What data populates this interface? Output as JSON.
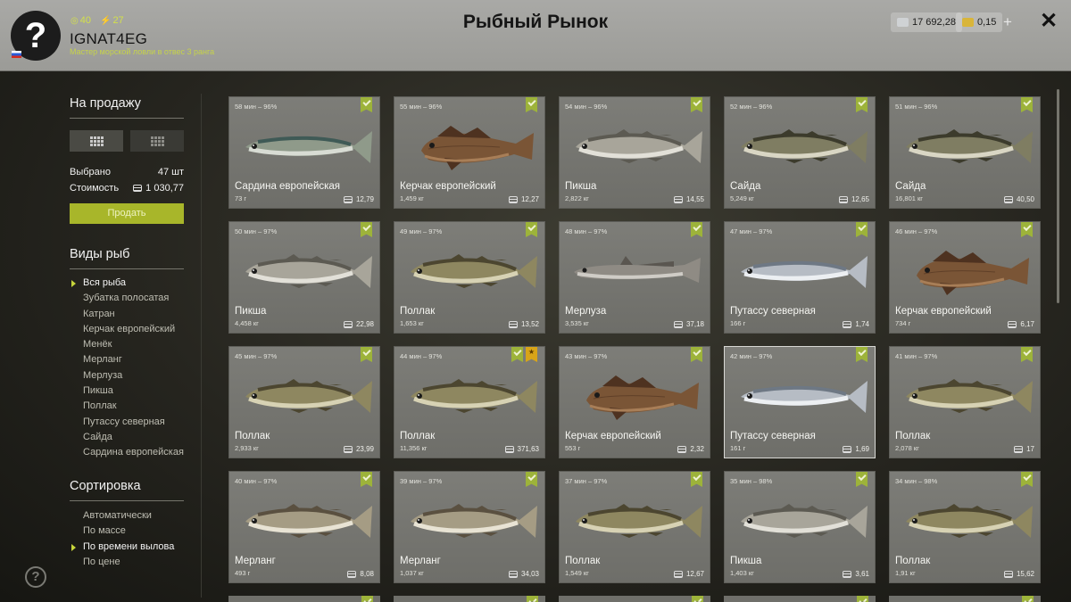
{
  "header": {
    "title": "Рыбный Рынок",
    "avatar_glyph": "?",
    "username": "IGNAT4EG",
    "rank_text": "Мастер морской ловли в отвес 3 ранга",
    "stat_1": "40",
    "stat_2": "27",
    "silver": "17 692,28",
    "gold": "0,15",
    "add_label": "+",
    "close_label": "✕",
    "colors": {
      "accent": "#d3e04a",
      "silver_coin": "#cfd2d4",
      "gold_coin": "#d9b53a"
    }
  },
  "sidebar": {
    "sale_heading": "На продажу",
    "selected_label": "Выбрано",
    "selected_value": "47 шт",
    "cost_label": "Стоимость",
    "cost_value": "1 030,77",
    "sell_button": "Продать",
    "species_heading": "Виды рыб",
    "species": [
      "Вся рыба",
      "Зубатка полосатая",
      "Катран",
      "Керчак европейский",
      "Менёк",
      "Мерланг",
      "Мерлуза",
      "Пикша",
      "Поллак",
      "Путассу северная",
      "Сайда",
      "Сардина европейская"
    ],
    "species_active": 0,
    "sort_heading": "Сортировка",
    "sort_options": [
      "Автоматически",
      "По массе",
      "По времени вылова",
      "По цене"
    ],
    "sort_active": 2,
    "help_glyph": "?"
  },
  "cards": [
    {
      "time": "58 мин – 96%",
      "name": "Сардина европейская",
      "weight": "73 г",
      "price": "12,79",
      "fish": "sardine"
    },
    {
      "time": "55 мин – 96%",
      "name": "Керчак европейский",
      "weight": "1,459 кг",
      "price": "12,27",
      "fish": "sculpin"
    },
    {
      "time": "54 мин – 96%",
      "name": "Пикша",
      "weight": "2,822 кг",
      "price": "14,55",
      "fish": "haddock"
    },
    {
      "time": "52 мин – 96%",
      "name": "Сайда",
      "weight": "5,249 кг",
      "price": "12,65",
      "fish": "saithe"
    },
    {
      "time": "51 мин – 96%",
      "name": "Сайда",
      "weight": "16,801 кг",
      "price": "40,50",
      "fish": "saithe"
    },
    {
      "time": "50 мин – 97%",
      "name": "Пикша",
      "weight": "4,458 кг",
      "price": "22,98",
      "fish": "haddock"
    },
    {
      "time": "49 мин – 97%",
      "name": "Поллак",
      "weight": "1,653 кг",
      "price": "13,52",
      "fish": "pollack"
    },
    {
      "time": "48 мин – 97%",
      "name": "Мерлуза",
      "weight": "3,535 кг",
      "price": "37,18",
      "fish": "hake"
    },
    {
      "time": "47 мин – 97%",
      "name": "Путассу северная",
      "weight": "166 г",
      "price": "1,74",
      "fish": "whiting-blue"
    },
    {
      "time": "46 мин – 97%",
      "name": "Керчак европейский",
      "weight": "734 г",
      "price": "6,17",
      "fish": "sculpin"
    },
    {
      "time": "45 мин – 97%",
      "name": "Поллак",
      "weight": "2,933 кг",
      "price": "23,99",
      "fish": "pollack"
    },
    {
      "time": "44 мин – 97%",
      "name": "Поллак",
      "weight": "11,356 кг",
      "price": "371,63",
      "fish": "pollack",
      "star": true
    },
    {
      "time": "43 мин – 97%",
      "name": "Керчак европейский",
      "weight": "553 г",
      "price": "2,32",
      "fish": "sculpin"
    },
    {
      "time": "42 мин – 97%",
      "name": "Путассу северная",
      "weight": "161 г",
      "price": "1,69",
      "fish": "whiting-blue",
      "highlight": true
    },
    {
      "time": "41 мин – 97%",
      "name": "Поллак",
      "weight": "2,078 кг",
      "price": "17",
      "fish": "pollack"
    },
    {
      "time": "40 мин – 97%",
      "name": "Мерланг",
      "weight": "493 г",
      "price": "8,08",
      "fish": "whiting"
    },
    {
      "time": "39 мин – 97%",
      "name": "Мерланг",
      "weight": "1,037 кг",
      "price": "34,03",
      "fish": "whiting"
    },
    {
      "time": "37 мин – 97%",
      "name": "Поллак",
      "weight": "1,549 кг",
      "price": "12,67",
      "fish": "pollack"
    },
    {
      "time": "35 мин – 98%",
      "name": "Пикша",
      "weight": "1,403 кг",
      "price": "3,61",
      "fish": "haddock"
    },
    {
      "time": "34 мин – 98%",
      "name": "Поллак",
      "weight": "1,91 кг",
      "price": "15,62",
      "fish": "pollack"
    }
  ],
  "fish_colors": {
    "sardine": {
      "body": "#8f9a8a",
      "belly": "#d8dcd4",
      "back": "#3f5a56"
    },
    "sculpin": {
      "body": "#7a5536",
      "belly": "#a87e57",
      "back": "#4e3220"
    },
    "haddock": {
      "body": "#a8a59a",
      "belly": "#e2e0d8",
      "back": "#5c5a52"
    },
    "saithe": {
      "body": "#7f7d62",
      "belly": "#d9d6c4",
      "back": "#3c3b2c"
    },
    "pollack": {
      "body": "#8e8760",
      "belly": "#d7d2b4",
      "back": "#4c4630"
    },
    "hake": {
      "body": "#8f8b84",
      "belly": "#cfccc6",
      "back": "#5a5650"
    },
    "whiting-blue": {
      "body": "#b6bcc4",
      "belly": "#eceff2",
      "back": "#6e7884"
    },
    "whiting": {
      "body": "#a59c84",
      "belly": "#e8e3d4",
      "back": "#5a5040"
    }
  }
}
